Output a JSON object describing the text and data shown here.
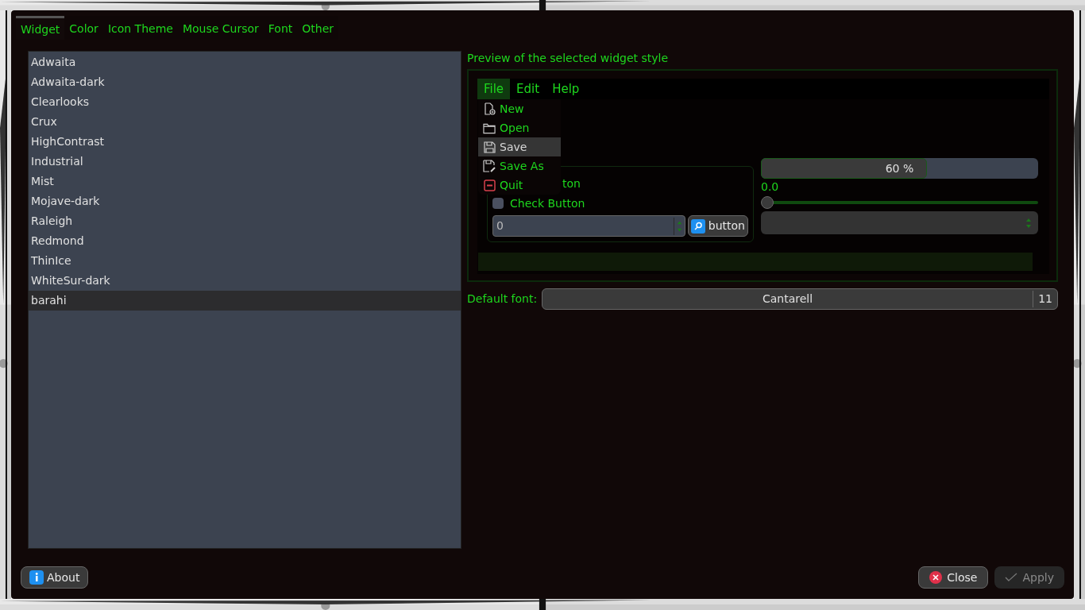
{
  "tabs": [
    {
      "label": "Widget",
      "selected": true
    },
    {
      "label": "Color",
      "selected": false
    },
    {
      "label": "Icon Theme",
      "selected": false
    },
    {
      "label": "Mouse Cursor",
      "selected": false
    },
    {
      "label": "Font",
      "selected": false
    },
    {
      "label": "Other",
      "selected": false
    }
  ],
  "themes": [
    {
      "label": "Adwaita",
      "selected": false
    },
    {
      "label": "Adwaita-dark",
      "selected": false
    },
    {
      "label": "Clearlooks",
      "selected": false
    },
    {
      "label": "Crux",
      "selected": false
    },
    {
      "label": "HighContrast",
      "selected": false
    },
    {
      "label": "Industrial",
      "selected": false
    },
    {
      "label": "Mist",
      "selected": false
    },
    {
      "label": "Mojave-dark",
      "selected": false
    },
    {
      "label": "Raleigh",
      "selected": false
    },
    {
      "label": "Redmond",
      "selected": false
    },
    {
      "label": "ThinIce",
      "selected": false
    },
    {
      "label": "WhiteSur-dark",
      "selected": false
    },
    {
      "label": "barahi",
      "selected": true
    }
  ],
  "preview": {
    "title": "Preview of the selected widget style",
    "menubar": [
      {
        "label": "File",
        "selected": true
      },
      {
        "label": "Edit",
        "selected": false
      },
      {
        "label": "Help",
        "selected": false
      }
    ],
    "menu": [
      {
        "label": "New",
        "kind": "new",
        "selected": false
      },
      {
        "label": "Open",
        "kind": "open",
        "selected": false
      },
      {
        "label": "Save",
        "kind": "save",
        "selected": true
      },
      {
        "label": "Save As",
        "kind": "saveas",
        "selected": false
      },
      {
        "label": "Quit",
        "kind": "quit",
        "selected": false
      }
    ],
    "radio": {
      "label": "ton"
    },
    "check": {
      "label": "Check Button",
      "checked": false
    },
    "spin": {
      "value": "0"
    },
    "button": {
      "label": "button"
    },
    "progress": {
      "level": 0.6,
      "reading": "60 %"
    },
    "scale": {
      "reading": "0.0",
      "level": 0
    }
  },
  "default_font": {
    "label": "Default font:",
    "value": "Cantarell",
    "size": "11"
  },
  "buttons": {
    "about": "About",
    "close": "Close",
    "apply": {
      "label": "Apply",
      "disabled": true
    }
  }
}
